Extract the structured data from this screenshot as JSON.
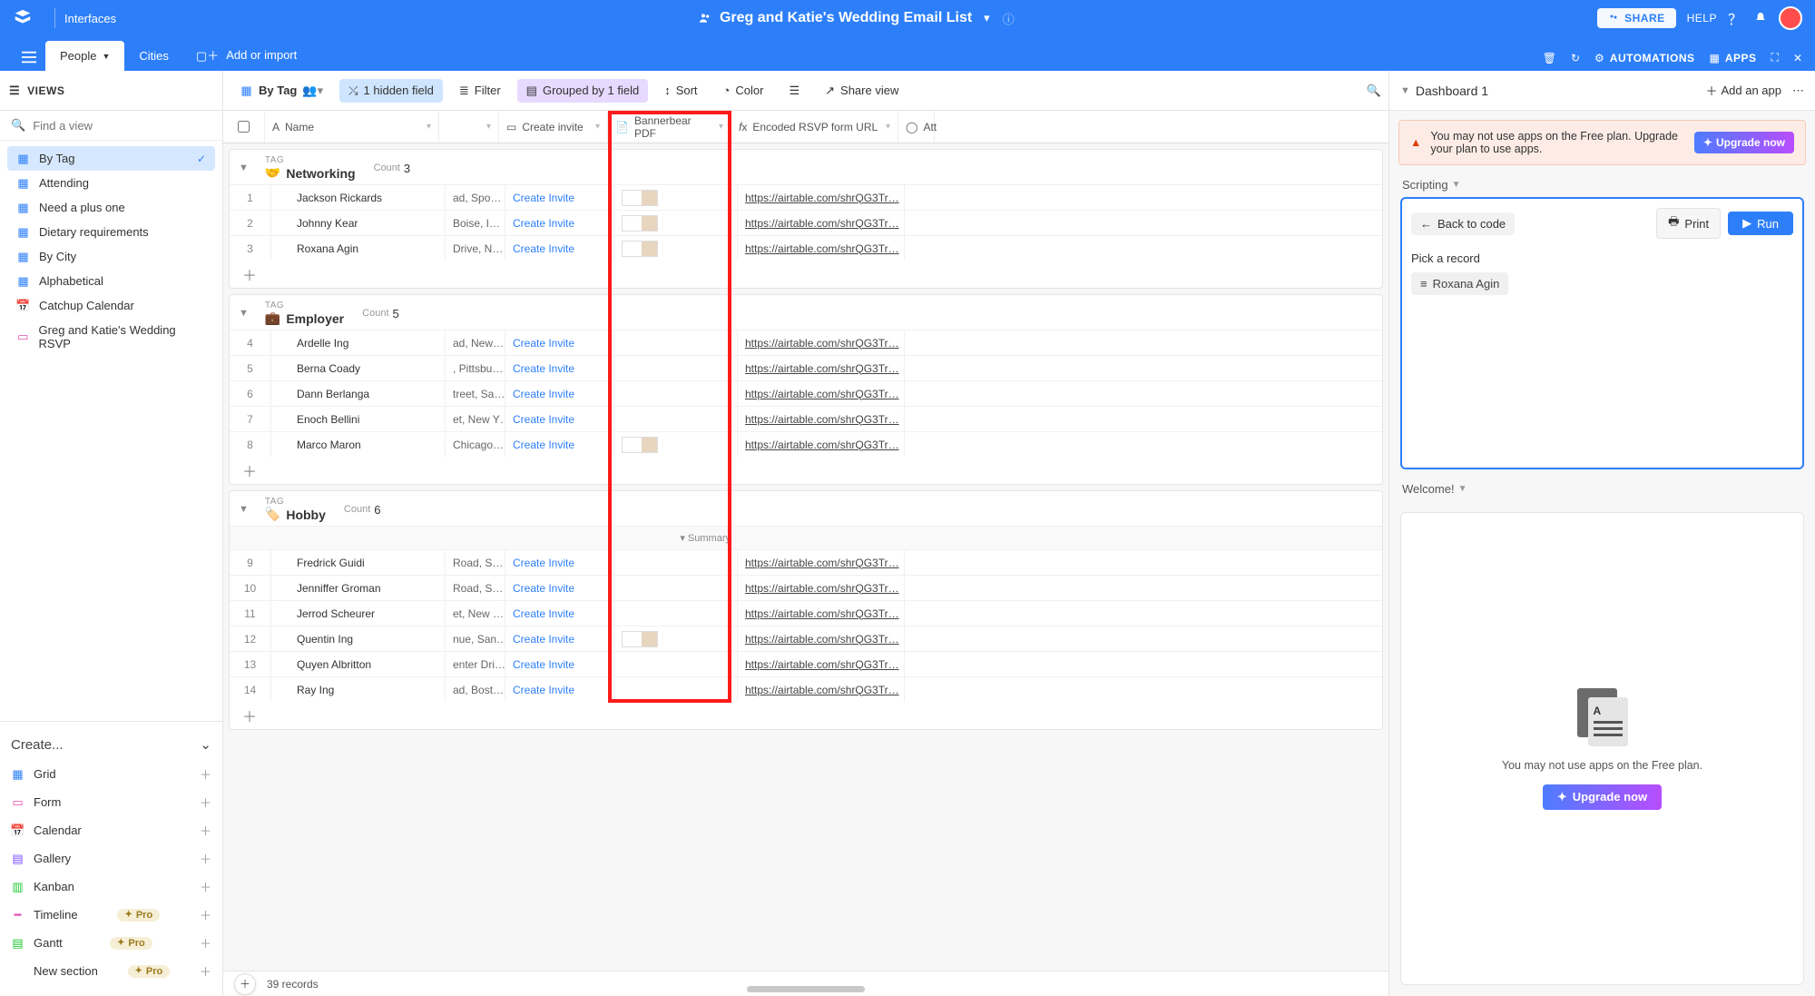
{
  "topbar": {
    "interfaces": "Interfaces",
    "title": "Greg and Katie's Wedding Email List",
    "share": "SHARE",
    "help": "HELP"
  },
  "tablebar": {
    "tab_people": "People",
    "tab_cities": "Cities",
    "add_import": "Add or import",
    "automations": "AUTOMATIONS",
    "apps": "APPS"
  },
  "ctrlbar": {
    "views": "VIEWS",
    "by_tag": "By Tag",
    "hidden": "1 hidden field",
    "filter": "Filter",
    "grouped": "Grouped by 1 field",
    "sort": "Sort",
    "color": "Color",
    "share_view": "Share view"
  },
  "leftsearch": {
    "placeholder": "Find a view"
  },
  "views": [
    {
      "label": "By Tag",
      "icon": "grid",
      "active": true
    },
    {
      "label": "Attending",
      "icon": "grid"
    },
    {
      "label": "Need a plus one",
      "icon": "grid"
    },
    {
      "label": "Dietary requirements",
      "icon": "grid"
    },
    {
      "label": "By City",
      "icon": "grid"
    },
    {
      "label": "Alphabetical",
      "icon": "grid"
    },
    {
      "label": "Catchup Calendar",
      "icon": "cal"
    },
    {
      "label": "Greg and Katie's Wedding RSVP",
      "icon": "form"
    }
  ],
  "create": {
    "head": "Create...",
    "rows": [
      {
        "label": "Grid",
        "icon": "grid"
      },
      {
        "label": "Form",
        "icon": "form"
      },
      {
        "label": "Calendar",
        "icon": "cal"
      },
      {
        "label": "Gallery",
        "icon": "gal"
      },
      {
        "label": "Kanban",
        "icon": "kan"
      },
      {
        "label": "Timeline",
        "icon": "tl",
        "pro": true
      },
      {
        "label": "Gantt",
        "icon": "gn",
        "pro": true
      },
      {
        "label": "New section",
        "pro": true
      }
    ],
    "pro_label": "Pro"
  },
  "columns": {
    "name": "Name",
    "create_invite": "Create invite",
    "bannerbear": "Bannerbear PDF",
    "encoded_url": "Encoded RSVP form URL",
    "att": "Att"
  },
  "group_labels": {
    "tag": "TAG",
    "count": "Count"
  },
  "groups": [
    {
      "name": "Networking",
      "emoji": "🤝",
      "count": 3,
      "rows": [
        {
          "n": 1,
          "name": "Jackson Rickards",
          "addr": "ad, Spo…",
          "thumb": true,
          "url": "https://airtable.com/shrQG3Tr…"
        },
        {
          "n": 2,
          "name": "Johnny Kear",
          "addr": "Boise, I…",
          "thumb": true,
          "url": "https://airtable.com/shrQG3Tr…"
        },
        {
          "n": 3,
          "name": "Roxana Agin",
          "addr": "Drive, N…",
          "thumb": true,
          "url": "https://airtable.com/shrQG3Tr…"
        }
      ]
    },
    {
      "name": "Employer",
      "emoji": "💼",
      "count": 5,
      "rows": [
        {
          "n": 4,
          "name": "Ardelle Ing",
          "addr": "ad, New…",
          "url": "https://airtable.com/shrQG3Tr…"
        },
        {
          "n": 5,
          "name": "Berna Coady",
          "addr": ", Pittsbu…",
          "url": "https://airtable.com/shrQG3Tr…"
        },
        {
          "n": 6,
          "name": "Dann Berlanga",
          "addr": "treet, Sa…",
          "url": "https://airtable.com/shrQG3Tr…"
        },
        {
          "n": 7,
          "name": "Enoch Bellini",
          "addr": "et, New Y…",
          "url": "https://airtable.com/shrQG3Tr…"
        },
        {
          "n": 8,
          "name": "Marco Maron",
          "addr": "Chicago…",
          "thumb": true,
          "url": "https://airtable.com/shrQG3Tr…"
        }
      ]
    },
    {
      "name": "Hobby",
      "emoji": "🏷️",
      "count": 6,
      "summary": true,
      "rows": [
        {
          "n": 9,
          "name": "Fredrick Guidi",
          "addr": "Road, S…",
          "url": "https://airtable.com/shrQG3Tr…"
        },
        {
          "n": 10,
          "name": "Jenniffer Groman",
          "addr": "Road, S…",
          "url": "https://airtable.com/shrQG3Tr…"
        },
        {
          "n": 11,
          "name": "Jerrod Scheurer",
          "addr": "et, New …",
          "url": "https://airtable.com/shrQG3Tr…"
        },
        {
          "n": 12,
          "name": "Quentin Ing",
          "addr": "nue, San…",
          "thumb": true,
          "url": "https://airtable.com/shrQG3Tr…"
        },
        {
          "n": 13,
          "name": "Quyen Albritton",
          "addr": "enter Dri…",
          "url": "https://airtable.com/shrQG3Tr…"
        },
        {
          "n": 14,
          "name": "Ray Ing",
          "addr": "ad, Bost…",
          "url": "https://airtable.com/shrQG3Tr…"
        }
      ]
    }
  ],
  "create_invite_link": "Create Invite",
  "summary_label": "Summary",
  "footer": {
    "records": "39 records"
  },
  "rightpanel": {
    "dashboard": "Dashboard 1",
    "add_app": "Add an app",
    "warning": "You may not use apps on the Free plan. Upgrade your plan to use apps.",
    "upgrade": "Upgrade now",
    "scripting": "Scripting",
    "back": "Back to code",
    "print": "Print",
    "run": "Run",
    "pick": "Pick a record",
    "record": "Roxana Agin",
    "welcome": "Welcome!",
    "welcome_text": "You may not use apps on the Free plan.",
    "welcome_btn": "Upgrade now"
  }
}
